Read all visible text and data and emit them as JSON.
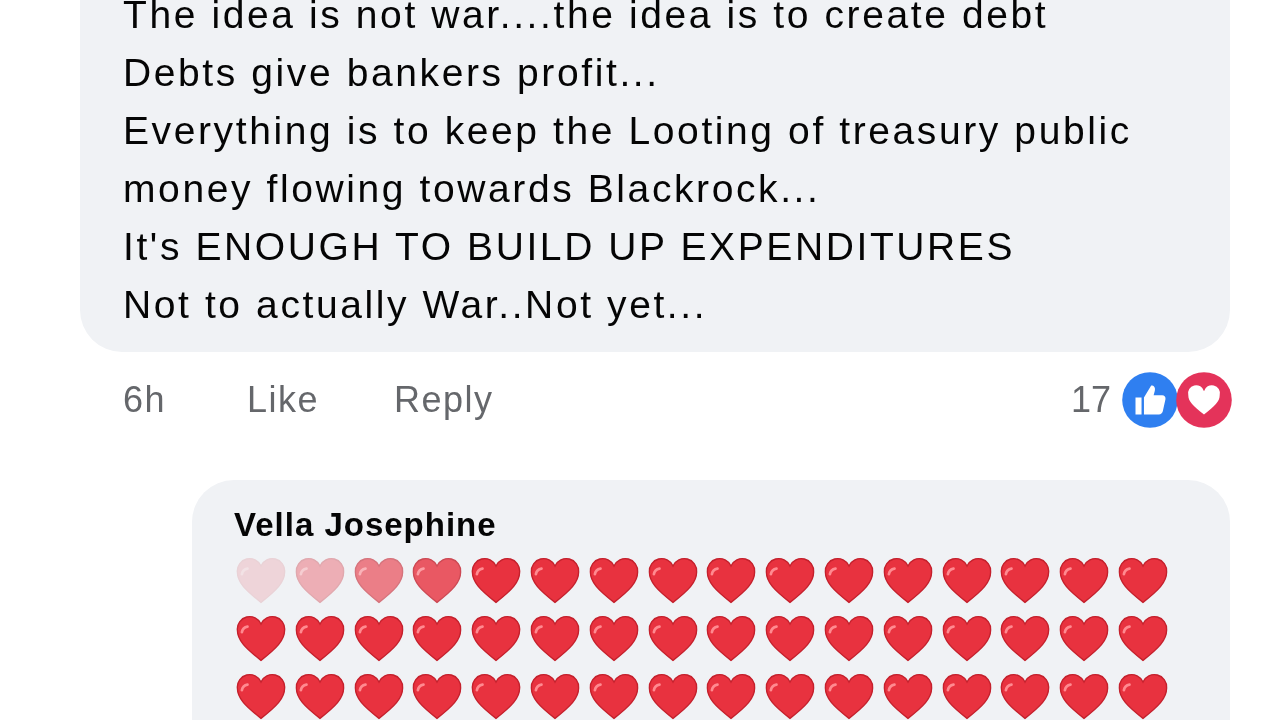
{
  "comment": {
    "lines": [
      "The idea is not war....the idea is to create debt",
      "Debts give bankers profit...",
      "Everything is to keep the Looting of treasury public",
      "money flowing towards Blackrock...",
      "It's ENOUGH TO BUILD UP EXPENDITURES",
      "Not to actually War..Not yet..."
    ],
    "time": "6h",
    "like": "Like",
    "reply": "Reply",
    "reaction_count": "17"
  },
  "reply": {
    "author": "Vella Josephine"
  }
}
